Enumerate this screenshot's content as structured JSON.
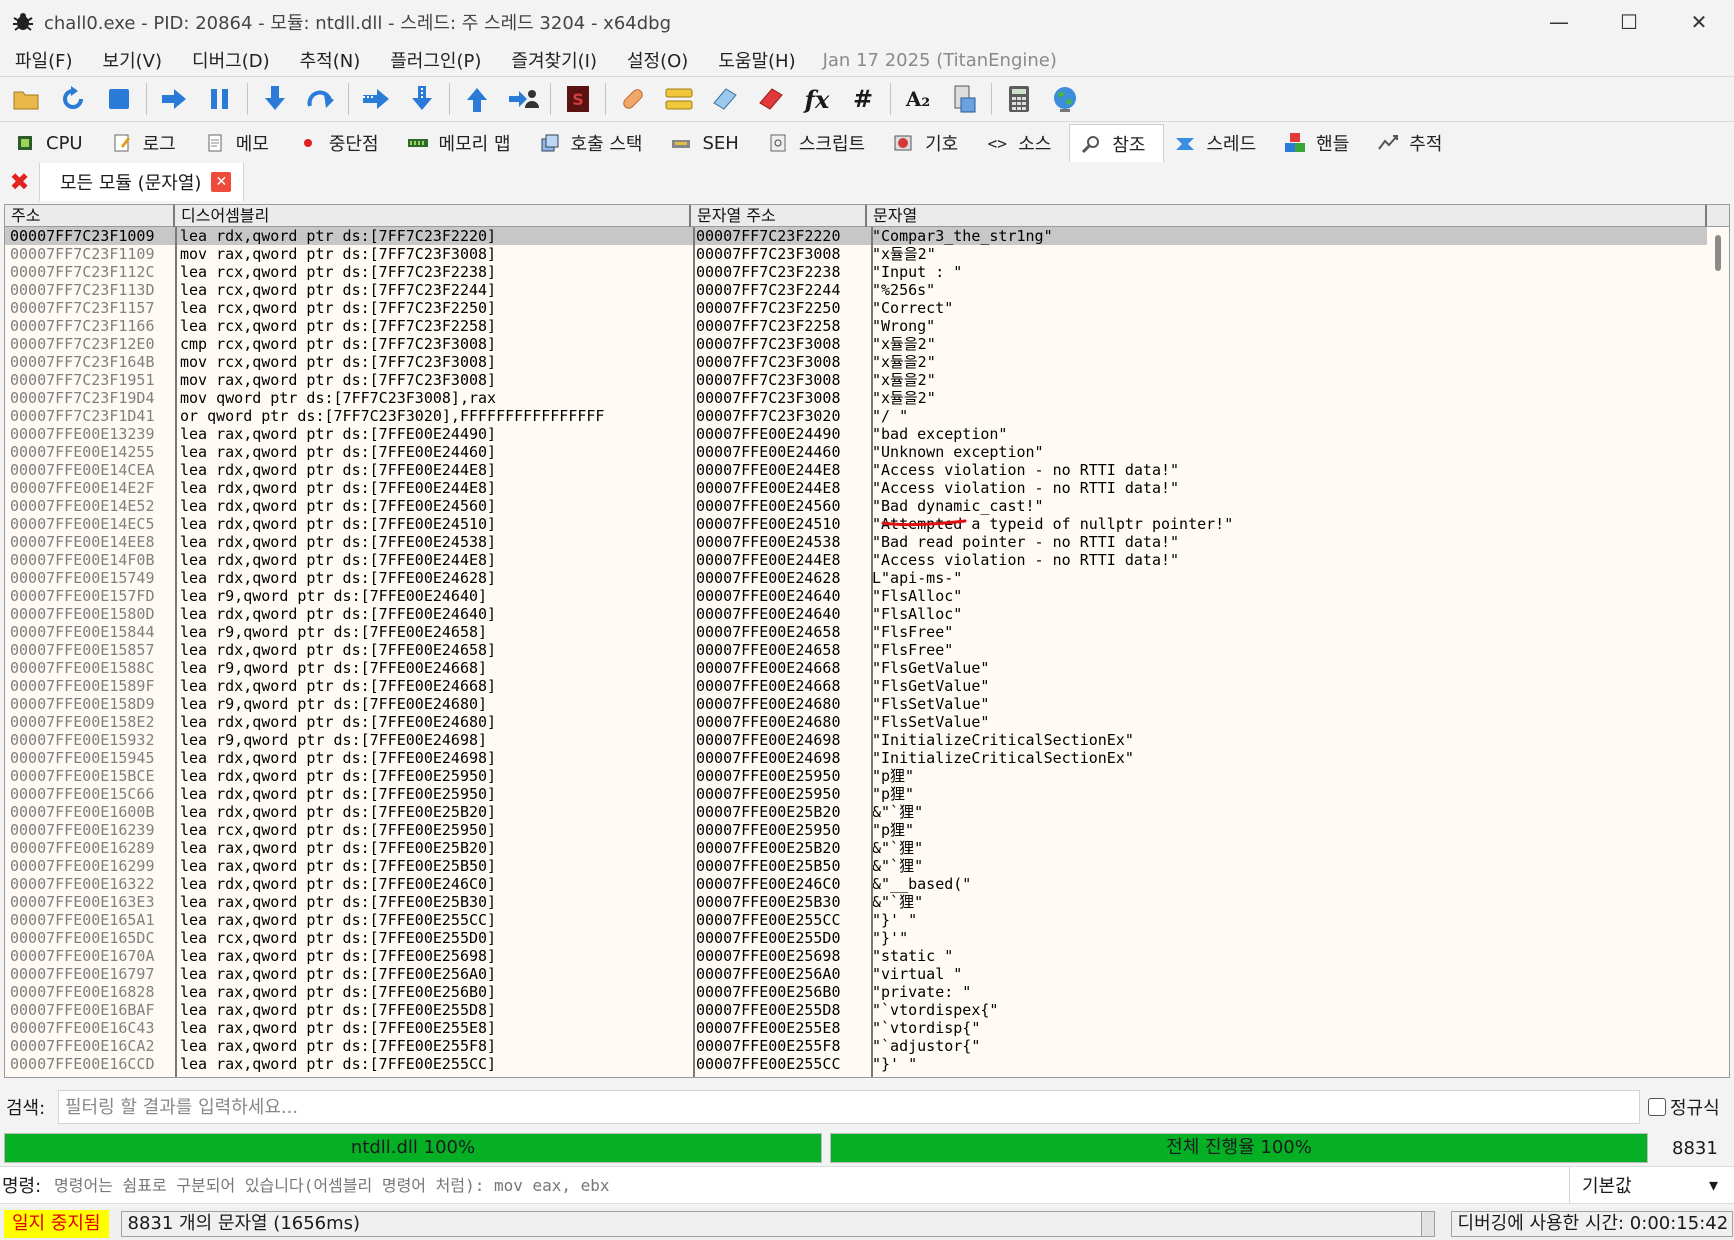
{
  "window": {
    "title": "chall0.exe - PID: 20864 - 모듈: ntdll.dll - 스레드: 주 스레드 3204 - x64dbg",
    "minimize": "—",
    "maximize": "☐",
    "close": "✕"
  },
  "menu": {
    "items": [
      "파일(F)",
      "보기(V)",
      "디버그(D)",
      "추적(N)",
      "플러그인(P)",
      "즐겨찾기(I)",
      "설정(O)",
      "도움말(H)"
    ],
    "info": "Jan 17 2025 (TitanEngine)"
  },
  "toolbar": {
    "icons": [
      "open-icon",
      "restart-icon",
      "stop-icon",
      "run-icon",
      "pause-icon",
      "step-into-icon",
      "step-over-icon",
      "trace-into-icon",
      "trace-over-icon",
      "run-to-user-icon",
      "execute-till-return-icon",
      "scylla-icon",
      "patch-icon",
      "comment-icon",
      "label-icon",
      "bookmark-icon",
      "function-icon",
      "hash-icon",
      "font-icon",
      "module-icon",
      "calculator-icon",
      "globe-icon"
    ],
    "fx_label": "fx",
    "hash_label": "#",
    "font_label": "A₂"
  },
  "tabs": [
    {
      "label": "CPU",
      "icon": "cpu-icon"
    },
    {
      "label": "로그",
      "icon": "log-icon"
    },
    {
      "label": "메모",
      "icon": "notes-icon"
    },
    {
      "label": "중단점",
      "icon": "breakpoint-icon"
    },
    {
      "label": "메모리 맵",
      "icon": "memory-map-icon"
    },
    {
      "label": "호출 스택",
      "icon": "call-stack-icon"
    },
    {
      "label": "SEH",
      "icon": "seh-icon"
    },
    {
      "label": "스크립트",
      "icon": "script-icon"
    },
    {
      "label": "기호",
      "icon": "symbols-icon"
    },
    {
      "label": "소스",
      "icon": "source-icon"
    },
    {
      "label": "참조",
      "icon": "references-icon",
      "active": true
    },
    {
      "label": "스레드",
      "icon": "threads-icon"
    },
    {
      "label": "핸들",
      "icon": "handles-icon"
    },
    {
      "label": "추적",
      "icon": "trace-icon"
    }
  ],
  "subtab": {
    "label": "모든 모듈 (문자열)"
  },
  "table": {
    "headers": [
      "주소",
      "디스어셈블리",
      "문자열 주소",
      "문자열"
    ],
    "rows": [
      [
        "00007FF7C23F1009",
        "lea rdx,qword ptr ds:[7FF7C23F2220]",
        "00007FF7C23F2220",
        "\"Compar3_the_str1ng\""
      ],
      [
        "00007FF7C23F1109",
        "mov rax,qword ptr ds:[7FF7C23F3008]",
        "00007FF7C23F3008",
        "\"x듈을2\""
      ],
      [
        "00007FF7C23F112C",
        "lea rcx,qword ptr ds:[7FF7C23F2238]",
        "00007FF7C23F2238",
        "\"Input : \""
      ],
      [
        "00007FF7C23F113D",
        "lea rcx,qword ptr ds:[7FF7C23F2244]",
        "00007FF7C23F2244",
        "\"%256s\""
      ],
      [
        "00007FF7C23F1157",
        "lea rcx,qword ptr ds:[7FF7C23F2250]",
        "00007FF7C23F2250",
        "\"Correct\""
      ],
      [
        "00007FF7C23F1166",
        "lea rcx,qword ptr ds:[7FF7C23F2258]",
        "00007FF7C23F2258",
        "\"Wrong\""
      ],
      [
        "00007FF7C23F12E0",
        "cmp rcx,qword ptr ds:[7FF7C23F3008]",
        "00007FF7C23F3008",
        "\"x듈을2\""
      ],
      [
        "00007FF7C23F164B",
        "mov rcx,qword ptr ds:[7FF7C23F3008]",
        "00007FF7C23F3008",
        "\"x듈을2\""
      ],
      [
        "00007FF7C23F1951",
        "mov rax,qword ptr ds:[7FF7C23F3008]",
        "00007FF7C23F3008",
        "\"x듈을2\""
      ],
      [
        "00007FF7C23F19D4",
        "mov qword ptr ds:[7FF7C23F3008],rax",
        "00007FF7C23F3008",
        "\"x듈을2\""
      ],
      [
        "00007FF7C23F1D41",
        "or qword ptr ds:[7FF7C23F3020],FFFFFFFFFFFFFFFF",
        "00007FF7C23F3020",
        "\"/ \""
      ],
      [
        "00007FFE00E13239",
        "lea rax,qword ptr ds:[7FFE00E24490]",
        "00007FFE00E24490",
        "\"bad exception\""
      ],
      [
        "00007FFE00E14255",
        "lea rax,qword ptr ds:[7FFE00E24460]",
        "00007FFE00E24460",
        "\"Unknown exception\""
      ],
      [
        "00007FFE00E14CEA",
        "lea rdx,qword ptr ds:[7FFE00E244E8]",
        "00007FFE00E244E8",
        "\"Access violation - no RTTI data!\""
      ],
      [
        "00007FFE00E14E2F",
        "lea rdx,qword ptr ds:[7FFE00E244E8]",
        "00007FFE00E244E8",
        "\"Access violation - no RTTI data!\""
      ],
      [
        "00007FFE00E14E52",
        "lea rdx,qword ptr ds:[7FFE00E24560]",
        "00007FFE00E24560",
        "\"Bad dynamic_cast!\""
      ],
      [
        "00007FFE00E14EC5",
        "lea rdx,qword ptr ds:[7FFE00E24510]",
        "00007FFE00E24510",
        "\"Attempted a typeid of nullptr pointer!\""
      ],
      [
        "00007FFE00E14EE8",
        "lea rdx,qword ptr ds:[7FFE00E24538]",
        "00007FFE00E24538",
        "\"Bad read pointer - no RTTI data!\""
      ],
      [
        "00007FFE00E14F0B",
        "lea rdx,qword ptr ds:[7FFE00E244E8]",
        "00007FFE00E244E8",
        "\"Access violation - no RTTI data!\""
      ],
      [
        "00007FFE00E15749",
        "lea rdx,qword ptr ds:[7FFE00E24628]",
        "00007FFE00E24628",
        "L\"api-ms-\""
      ],
      [
        "00007FFE00E157FD",
        "lea r9,qword ptr ds:[7FFE00E24640]",
        "00007FFE00E24640",
        "\"FlsAlloc\""
      ],
      [
        "00007FFE00E1580D",
        "lea rdx,qword ptr ds:[7FFE00E24640]",
        "00007FFE00E24640",
        "\"FlsAlloc\""
      ],
      [
        "00007FFE00E15844",
        "lea r9,qword ptr ds:[7FFE00E24658]",
        "00007FFE00E24658",
        "\"FlsFree\""
      ],
      [
        "00007FFE00E15857",
        "lea rdx,qword ptr ds:[7FFE00E24658]",
        "00007FFE00E24658",
        "\"FlsFree\""
      ],
      [
        "00007FFE00E1588C",
        "lea r9,qword ptr ds:[7FFE00E24668]",
        "00007FFE00E24668",
        "\"FlsGetValue\""
      ],
      [
        "00007FFE00E1589F",
        "lea rdx,qword ptr ds:[7FFE00E24668]",
        "00007FFE00E24668",
        "\"FlsGetValue\""
      ],
      [
        "00007FFE00E158D9",
        "lea r9,qword ptr ds:[7FFE00E24680]",
        "00007FFE00E24680",
        "\"FlsSetValue\""
      ],
      [
        "00007FFE00E158E2",
        "lea rdx,qword ptr ds:[7FFE00E24680]",
        "00007FFE00E24680",
        "\"FlsSetValue\""
      ],
      [
        "00007FFE00E15932",
        "lea r9,qword ptr ds:[7FFE00E24698]",
        "00007FFE00E24698",
        "\"InitializeCriticalSectionEx\""
      ],
      [
        "00007FFE00E15945",
        "lea rdx,qword ptr ds:[7FFE00E24698]",
        "00007FFE00E24698",
        "\"InitializeCriticalSectionEx\""
      ],
      [
        "00007FFE00E15BCE",
        "lea rdx,qword ptr ds:[7FFE00E25950]",
        "00007FFE00E25950",
        "\"p狸\""
      ],
      [
        "00007FFE00E15C66",
        "lea rdx,qword ptr ds:[7FFE00E25950]",
        "00007FFE00E25950",
        "\"p狸\""
      ],
      [
        "00007FFE00E1600B",
        "lea rdx,qword ptr ds:[7FFE00E25B20]",
        "00007FFE00E25B20",
        "&\"`狸\""
      ],
      [
        "00007FFE00E16239",
        "lea rcx,qword ptr ds:[7FFE00E25950]",
        "00007FFE00E25950",
        "\"p狸\""
      ],
      [
        "00007FFE00E16289",
        "lea rax,qword ptr ds:[7FFE00E25B20]",
        "00007FFE00E25B20",
        "&\"`狸\""
      ],
      [
        "00007FFE00E16299",
        "lea rax,qword ptr ds:[7FFE00E25B50]",
        "00007FFE00E25B50",
        "&\"`狸\""
      ],
      [
        "00007FFE00E16322",
        "lea rdx,qword ptr ds:[7FFE00E246C0]",
        "00007FFE00E246C0",
        "&\"__based(\""
      ],
      [
        "00007FFE00E163E3",
        "lea rax,qword ptr ds:[7FFE00E25B30]",
        "00007FFE00E25B30",
        "&\"`狸\""
      ],
      [
        "00007FFE00E165A1",
        "lea rax,qword ptr ds:[7FFE00E255CC]",
        "00007FFE00E255CC",
        "\"}' \""
      ],
      [
        "00007FFE00E165DC",
        "lea rcx,qword ptr ds:[7FFE00E255D0]",
        "00007FFE00E255D0",
        "\"}'\""
      ],
      [
        "00007FFE00E1670A",
        "lea rax,qword ptr ds:[7FFE00E25698]",
        "00007FFE00E25698",
        "\"static \""
      ],
      [
        "00007FFE00E16797",
        "lea rax,qword ptr ds:[7FFE00E256A0]",
        "00007FFE00E256A0",
        "\"virtual \""
      ],
      [
        "00007FFE00E16828",
        "lea rax,qword ptr ds:[7FFE00E256B0]",
        "00007FFE00E256B0",
        "\"private: \""
      ],
      [
        "00007FFE00E16BAF",
        "lea rax,qword ptr ds:[7FFE00E255D8]",
        "00007FFE00E255D8",
        "\"`vtordispex{\""
      ],
      [
        "00007FFE00E16C43",
        "lea rax,qword ptr ds:[7FFE00E255E8]",
        "00007FFE00E255E8",
        "\"`vtordisp{\""
      ],
      [
        "00007FFE00E16CA2",
        "lea rax,qword ptr ds:[7FFE00E255F8]",
        "00007FFE00E255F8",
        "\"`adjustor{\""
      ],
      [
        "00007FFE00E16CCD",
        "lea rax,qword ptr ds:[7FFE00E255CC]",
        "00007FFE00E255CC",
        "\"}' \""
      ]
    ]
  },
  "search": {
    "label": "검색:",
    "placeholder": "필터링 할 결과를 입력하세요...",
    "regex_label": "정규식"
  },
  "progress": {
    "module_label": "ntdll.dll 100%",
    "module_value": 1.0,
    "total_label": "전체 진행율 100%",
    "total_value": 1.0,
    "count": "8831",
    "color": "#06b025"
  },
  "command": {
    "label": "명령:",
    "placeholder": "명령어는 쉼표로 구분되어 있습니다(어셈블리 명령어 처럼): mov eax, ebx",
    "dropdown": "기본값",
    "dropdown_arrow": "▾"
  },
  "status": {
    "state": "일지 중지됨",
    "message": "8831 개의 문자열 (1656ms)",
    "time": "디버깅에 사용한 시간: 0:00:15:42"
  }
}
